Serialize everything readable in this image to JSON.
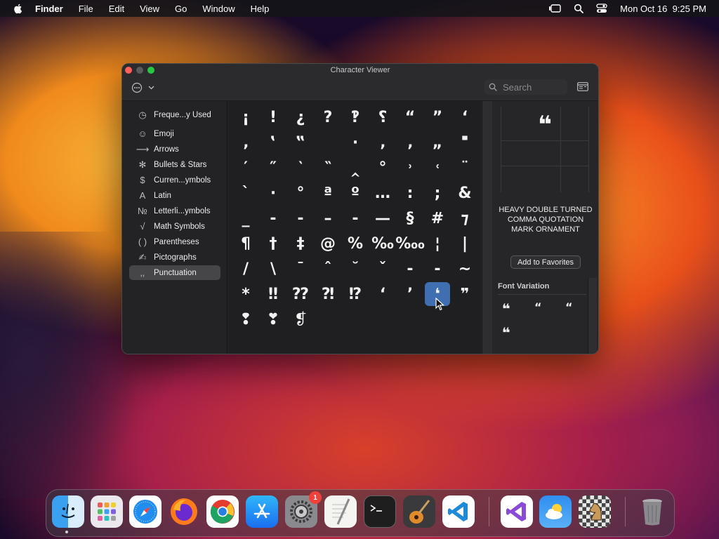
{
  "menubar": {
    "app": "Finder",
    "items": [
      "File",
      "Edit",
      "View",
      "Go",
      "Window",
      "Help"
    ],
    "clock": "Mon Oct 16  9:25 PM"
  },
  "window": {
    "title": "Character Viewer",
    "search_placeholder": "Search"
  },
  "sidebar": {
    "items": [
      {
        "label": "Freque...y Used",
        "icon": "clock-icon"
      },
      {
        "label": "Emoji",
        "icon": "smiley-icon"
      },
      {
        "label": "Arrows",
        "icon": "arrow-icon"
      },
      {
        "label": "Bullets & Stars",
        "icon": "asterisk-icon"
      },
      {
        "label": "Curren...ymbols",
        "icon": "dollar-icon"
      },
      {
        "label": "Latin",
        "icon": "letter-a-icon"
      },
      {
        "label": "Letterli...ymbols",
        "icon": "numero-icon"
      },
      {
        "label": "Math Symbols",
        "icon": "sqrt-icon"
      },
      {
        "label": "Parentheses",
        "icon": "parentheses-icon"
      },
      {
        "label": "Pictographs",
        "icon": "pictograph-icon"
      },
      {
        "label": "Punctuation",
        "icon": "punctuation-icon"
      }
    ],
    "selected": 10
  },
  "grid": {
    "rows": [
      [
        "¡",
        "!",
        "¿",
        "?",
        "‽",
        "⸮",
        "“",
        "”",
        "‘"
      ],
      [
        "‚",
        "‛",
        "‟",
        "",
        "·",
        "‚",
        "‚",
        "„",
        "'",
        "\""
      ],
      [
        "′",
        "″",
        "‵",
        "‶",
        "‸",
        "°",
        "˒",
        "˓",
        "¨"
      ],
      [
        "`",
        "·",
        "°",
        "ª",
        "º",
        "…",
        ":",
        ";",
        "&"
      ],
      [
        "_",
        "‐",
        "-",
        "–",
        "‑",
        "—",
        "§",
        "#",
        "⁊"
      ],
      [
        "¶",
        "†",
        "‡",
        "@",
        "%",
        "‰",
        "‱",
        "¦",
        "|"
      ],
      [
        "/",
        "\\",
        "¯",
        "ˆ",
        "˘",
        "ˇ",
        "-",
        "-",
        "~"
      ],
      [
        "*",
        "‼",
        "⁇",
        "⁈",
        "⁉",
        "‘",
        "’",
        "❛",
        "❞"
      ],
      [
        "❢",
        "❣",
        "❡"
      ]
    ],
    "selected_glyph": "❛"
  },
  "detail": {
    "preview_glyph": "❝",
    "char_name": "HEAVY DOUBLE TURNED COMMA QUOTATION MARK ORNAMENT",
    "favorites_label": "Add to Favorites",
    "font_variation_label": "Font Variation",
    "variations": [
      "❝",
      "“",
      "“",
      "❝"
    ]
  },
  "dock": {
    "apps": [
      "Finder",
      "Launchpad",
      "Safari",
      "Firefox",
      "Chrome",
      "App Store",
      "System Settings",
      "TextEdit",
      "Terminal",
      "GarageBand",
      "VS Code",
      "Visual Studio",
      "Weather",
      "Chess",
      "Trash"
    ],
    "settings_badge": "1"
  }
}
